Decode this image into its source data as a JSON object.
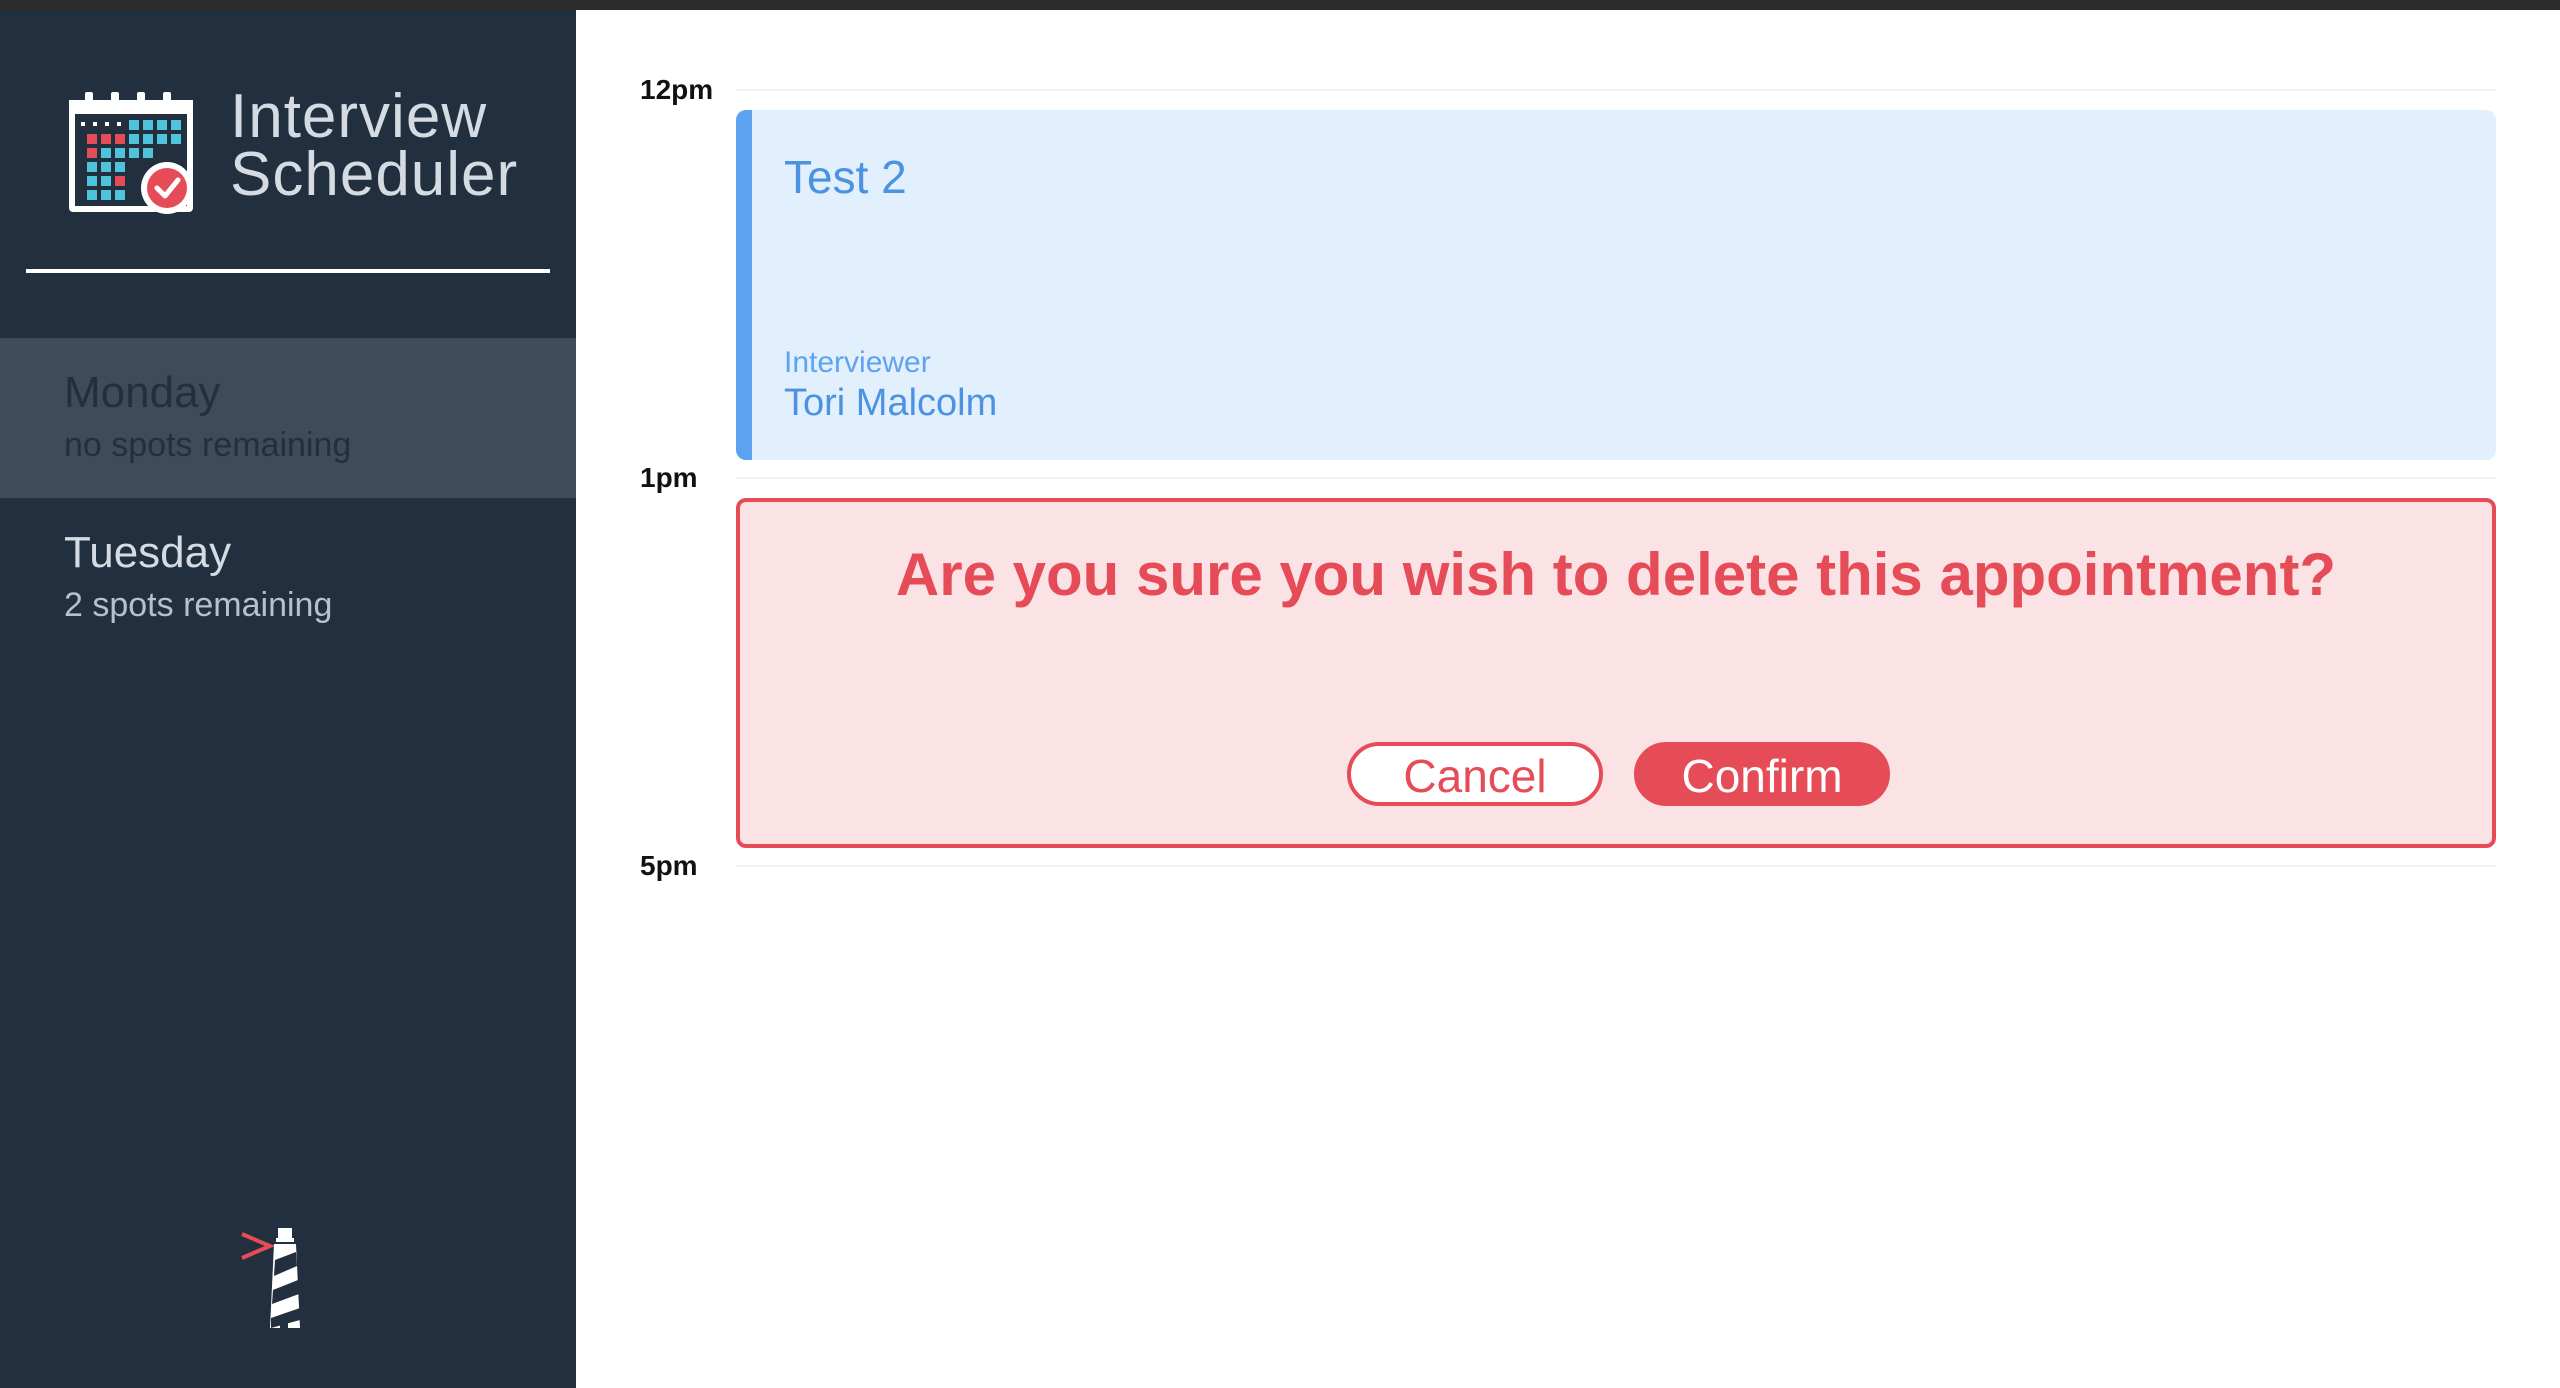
{
  "app": {
    "title_line1": "Interview",
    "title_line2": "Scheduler"
  },
  "sidebar": {
    "days": [
      {
        "name": "Monday",
        "spots": "no spots remaining",
        "selected": true
      },
      {
        "name": "Tuesday",
        "spots": "2 spots remaining",
        "selected": false
      }
    ]
  },
  "schedule": {
    "times": [
      "12pm",
      "1pm",
      "5pm"
    ],
    "appointment": {
      "student": "Test 2",
      "interviewer_label": "Interviewer",
      "interviewer_name": "Tori Malcolm"
    },
    "confirm": {
      "message": "Are you sure you wish to delete this appointment?",
      "cancel_label": "Cancel",
      "confirm_label": "Confirm"
    }
  },
  "colors": {
    "sidebar_bg": "#222f3e",
    "selected_day_bg": "#3f4b5b",
    "appointment_bg": "#e2effd",
    "appointment_accent": "#5ca2f0",
    "danger": "#e64c57",
    "danger_bg": "#fbe3e5"
  },
  "icons": {
    "brand": "calendar-check-icon",
    "footer": "lighthouse-logo"
  }
}
